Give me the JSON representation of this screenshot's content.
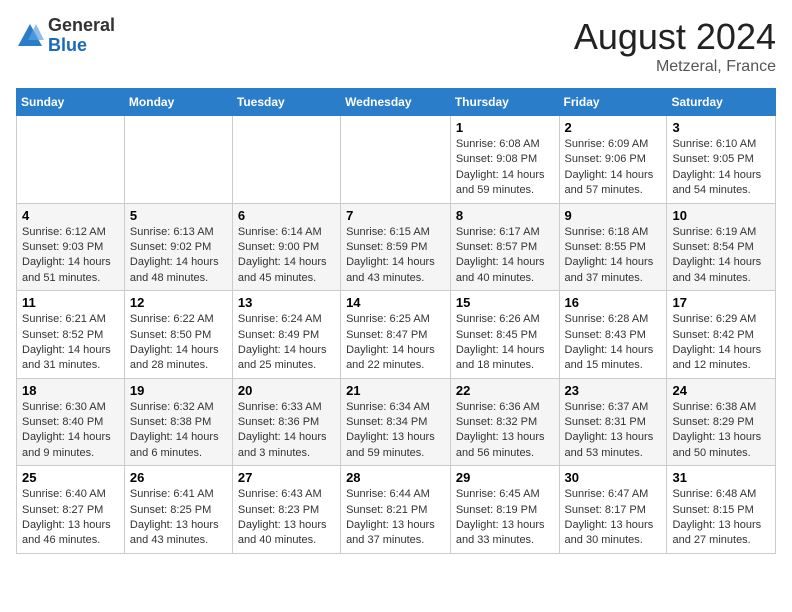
{
  "header": {
    "logo_general": "General",
    "logo_blue": "Blue",
    "month_year": "August 2024",
    "location": "Metzeral, France"
  },
  "weekdays": [
    "Sunday",
    "Monday",
    "Tuesday",
    "Wednesday",
    "Thursday",
    "Friday",
    "Saturday"
  ],
  "weeks": [
    [
      {
        "day": "",
        "info": ""
      },
      {
        "day": "",
        "info": ""
      },
      {
        "day": "",
        "info": ""
      },
      {
        "day": "",
        "info": ""
      },
      {
        "day": "1",
        "info": "Sunrise: 6:08 AM\nSunset: 9:08 PM\nDaylight: 14 hours and 59 minutes."
      },
      {
        "day": "2",
        "info": "Sunrise: 6:09 AM\nSunset: 9:06 PM\nDaylight: 14 hours and 57 minutes."
      },
      {
        "day": "3",
        "info": "Sunrise: 6:10 AM\nSunset: 9:05 PM\nDaylight: 14 hours and 54 minutes."
      }
    ],
    [
      {
        "day": "4",
        "info": "Sunrise: 6:12 AM\nSunset: 9:03 PM\nDaylight: 14 hours and 51 minutes."
      },
      {
        "day": "5",
        "info": "Sunrise: 6:13 AM\nSunset: 9:02 PM\nDaylight: 14 hours and 48 minutes."
      },
      {
        "day": "6",
        "info": "Sunrise: 6:14 AM\nSunset: 9:00 PM\nDaylight: 14 hours and 45 minutes."
      },
      {
        "day": "7",
        "info": "Sunrise: 6:15 AM\nSunset: 8:59 PM\nDaylight: 14 hours and 43 minutes."
      },
      {
        "day": "8",
        "info": "Sunrise: 6:17 AM\nSunset: 8:57 PM\nDaylight: 14 hours and 40 minutes."
      },
      {
        "day": "9",
        "info": "Sunrise: 6:18 AM\nSunset: 8:55 PM\nDaylight: 14 hours and 37 minutes."
      },
      {
        "day": "10",
        "info": "Sunrise: 6:19 AM\nSunset: 8:54 PM\nDaylight: 14 hours and 34 minutes."
      }
    ],
    [
      {
        "day": "11",
        "info": "Sunrise: 6:21 AM\nSunset: 8:52 PM\nDaylight: 14 hours and 31 minutes."
      },
      {
        "day": "12",
        "info": "Sunrise: 6:22 AM\nSunset: 8:50 PM\nDaylight: 14 hours and 28 minutes."
      },
      {
        "day": "13",
        "info": "Sunrise: 6:24 AM\nSunset: 8:49 PM\nDaylight: 14 hours and 25 minutes."
      },
      {
        "day": "14",
        "info": "Sunrise: 6:25 AM\nSunset: 8:47 PM\nDaylight: 14 hours and 22 minutes."
      },
      {
        "day": "15",
        "info": "Sunrise: 6:26 AM\nSunset: 8:45 PM\nDaylight: 14 hours and 18 minutes."
      },
      {
        "day": "16",
        "info": "Sunrise: 6:28 AM\nSunset: 8:43 PM\nDaylight: 14 hours and 15 minutes."
      },
      {
        "day": "17",
        "info": "Sunrise: 6:29 AM\nSunset: 8:42 PM\nDaylight: 14 hours and 12 minutes."
      }
    ],
    [
      {
        "day": "18",
        "info": "Sunrise: 6:30 AM\nSunset: 8:40 PM\nDaylight: 14 hours and 9 minutes."
      },
      {
        "day": "19",
        "info": "Sunrise: 6:32 AM\nSunset: 8:38 PM\nDaylight: 14 hours and 6 minutes."
      },
      {
        "day": "20",
        "info": "Sunrise: 6:33 AM\nSunset: 8:36 PM\nDaylight: 14 hours and 3 minutes."
      },
      {
        "day": "21",
        "info": "Sunrise: 6:34 AM\nSunset: 8:34 PM\nDaylight: 13 hours and 59 minutes."
      },
      {
        "day": "22",
        "info": "Sunrise: 6:36 AM\nSunset: 8:32 PM\nDaylight: 13 hours and 56 minutes."
      },
      {
        "day": "23",
        "info": "Sunrise: 6:37 AM\nSunset: 8:31 PM\nDaylight: 13 hours and 53 minutes."
      },
      {
        "day": "24",
        "info": "Sunrise: 6:38 AM\nSunset: 8:29 PM\nDaylight: 13 hours and 50 minutes."
      }
    ],
    [
      {
        "day": "25",
        "info": "Sunrise: 6:40 AM\nSunset: 8:27 PM\nDaylight: 13 hours and 46 minutes."
      },
      {
        "day": "26",
        "info": "Sunrise: 6:41 AM\nSunset: 8:25 PM\nDaylight: 13 hours and 43 minutes."
      },
      {
        "day": "27",
        "info": "Sunrise: 6:43 AM\nSunset: 8:23 PM\nDaylight: 13 hours and 40 minutes."
      },
      {
        "day": "28",
        "info": "Sunrise: 6:44 AM\nSunset: 8:21 PM\nDaylight: 13 hours and 37 minutes."
      },
      {
        "day": "29",
        "info": "Sunrise: 6:45 AM\nSunset: 8:19 PM\nDaylight: 13 hours and 33 minutes."
      },
      {
        "day": "30",
        "info": "Sunrise: 6:47 AM\nSunset: 8:17 PM\nDaylight: 13 hours and 30 minutes."
      },
      {
        "day": "31",
        "info": "Sunrise: 6:48 AM\nSunset: 8:15 PM\nDaylight: 13 hours and 27 minutes."
      }
    ]
  ]
}
